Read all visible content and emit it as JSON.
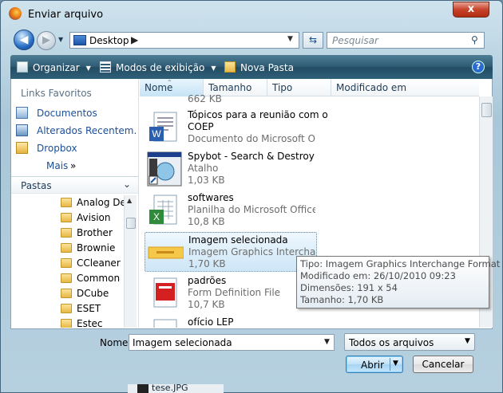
{
  "window": {
    "title": "Enviar arquivo",
    "close_label": "x"
  },
  "navbar": {
    "address": "Desktop",
    "address_separator": "▶",
    "search_placeholder": "Pesquisar"
  },
  "toolbar": {
    "organize": "Organizar",
    "views": "Modos de exibição",
    "new_folder": "Nova Pasta",
    "help": "?"
  },
  "sidebar": {
    "favorites_header": "Links Favoritos",
    "favorites": [
      {
        "label": "Documentos",
        "icon": "documents-icon"
      },
      {
        "label": "Alterados Recentem...",
        "icon": "recent-icon"
      },
      {
        "label": "Dropbox",
        "icon": "dropbox-icon"
      }
    ],
    "more_label": "Mais",
    "more_chevron": "»",
    "folders_header": "Pastas",
    "folders": [
      "Analog Devices",
      "Avision",
      "Brother",
      "Brownie",
      "CCleaner",
      "Common Files",
      "DCube",
      "ESET",
      "Estec"
    ]
  },
  "columns": [
    "Nome",
    "Tamanho",
    "Tipo",
    "Modificado em"
  ],
  "files": [
    {
      "name": "",
      "lines": [
        "662 KB"
      ],
      "icon": "document-icon",
      "partial": true
    },
    {
      "name": "Tópicos para a reunião com o",
      "lines": [
        "COEP",
        "Documento do Microsoft O..."
      ],
      "icon": "word-document-icon",
      "dark_first": true
    },
    {
      "name": "Spybot - Search & Destroy",
      "lines": [
        "Atalho",
        "1,03 KB"
      ],
      "icon": "spybot-icon"
    },
    {
      "name": "softwares",
      "lines": [
        "Planilha do Microsoft Office...",
        "10,8 KB"
      ],
      "icon": "excel-spreadsheet-icon"
    },
    {
      "name": "Imagem selecionada",
      "lines": [
        "Imagem Graphics Interchan...",
        "1,70 KB"
      ],
      "icon": "gif-image-icon",
      "selected": true
    },
    {
      "name": "padrões",
      "lines": [
        "Form Definition File",
        "10,7 KB"
      ],
      "icon": "pdf-form-icon"
    },
    {
      "name": "ofício LEP",
      "lines": [],
      "icon": "document-icon",
      "partial": true
    }
  ],
  "tooltip": {
    "type": "Tipo: Imagem Graphics Interchange Format",
    "modified": "Modificado em: 26/10/2010 09:23",
    "dimensions": "Dimensões: 191 x 54",
    "size": "Tamanho: 1,70 KB"
  },
  "bottom": {
    "name_label": "Nome:",
    "name_value": "Imagem selecionada",
    "filter": "Todos os arquivos",
    "open": "Abrir",
    "cancel": "Cancelar"
  },
  "background_window": {
    "file": "tese.JPG"
  },
  "colors": {
    "toolbar": "#2e5b73",
    "link": "#1b4f9a",
    "selection": "#cde6f7",
    "close_button": "#c7432a"
  }
}
